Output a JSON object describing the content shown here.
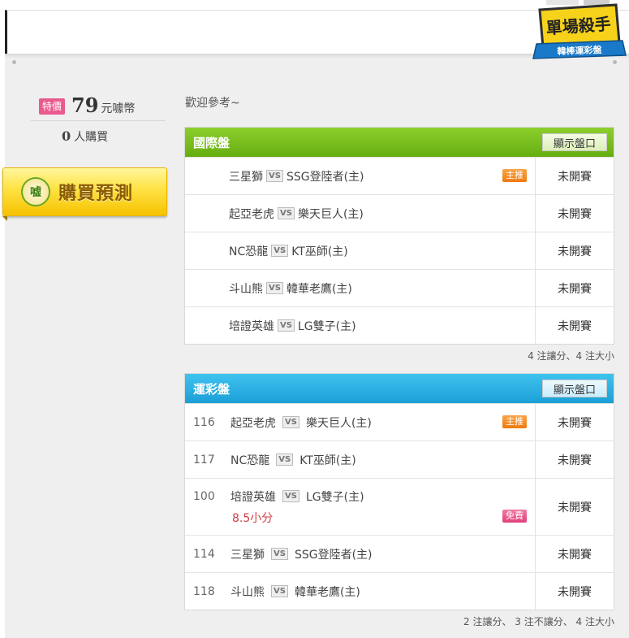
{
  "logo": {
    "main": "單場殺手",
    "sub": "韓棒運彩盤"
  },
  "sidebar": {
    "special_tag": "特價",
    "price": "79",
    "price_unit": "元噱幣",
    "buyers_count": "0",
    "buyers_label": "人購買",
    "buy_icon": "嘘",
    "buy_label": "購買預測"
  },
  "welcome": "歡迎參考~",
  "boards": [
    {
      "title": "國際盤",
      "show_button": "顯示盤口",
      "rows": [
        {
          "num": "",
          "home": "三星獅",
          "vs": "VS",
          "away": "SSG登陸者(主)",
          "badge": "主推",
          "status": "未開賽"
        },
        {
          "num": "",
          "home": "起亞老虎",
          "vs": "VS",
          "away": "樂天巨人(主)",
          "badge": "",
          "status": "未開賽"
        },
        {
          "num": "",
          "home": "NC恐龍",
          "vs": "VS",
          "away": "KT巫師(主)",
          "badge": "",
          "status": "未開賽"
        },
        {
          "num": "",
          "home": "斗山熊",
          "vs": "VS",
          "away": "韓華老鷹(主)",
          "badge": "",
          "status": "未開賽"
        },
        {
          "num": "",
          "home": "培證英雄",
          "vs": "VS",
          "away": "LG雙子(主)",
          "badge": "",
          "status": "未開賽"
        }
      ],
      "note": "4 注讓分、4 注大小"
    },
    {
      "title": "運彩盤",
      "show_button": "顯示盤口",
      "rows": [
        {
          "num": "116",
          "home": "起亞老虎",
          "vs": "VS",
          "away": "樂天巨人(主)",
          "badge": "主推",
          "status": "未開賽"
        },
        {
          "num": "117",
          "home": "NC恐龍",
          "vs": "VS",
          "away": "KT巫師(主)",
          "badge": "",
          "status": "未開賽"
        },
        {
          "num": "100",
          "home": "培證英雄",
          "vs": "VS",
          "away": "LG雙子(主)",
          "sub": "8.5小分",
          "badge": "免費",
          "status": "未開賽"
        },
        {
          "num": "114",
          "home": "三星獅",
          "vs": "VS",
          "away": "SSG登陸者(主)",
          "badge": "",
          "status": "未開賽"
        },
        {
          "num": "118",
          "home": "斗山熊",
          "vs": "VS",
          "away": "韓華老鷹(主)",
          "badge": "",
          "status": "未開賽"
        }
      ],
      "note": "2 注讓分、 3 注不讓分、 4 注大小"
    }
  ],
  "colors": {
    "green_header": "#67ad10",
    "blue_header": "#1c9fd6",
    "accent_red": "#d23b40",
    "badge_orange": "#ee7a0c",
    "badge_pink": "#e0407a"
  }
}
